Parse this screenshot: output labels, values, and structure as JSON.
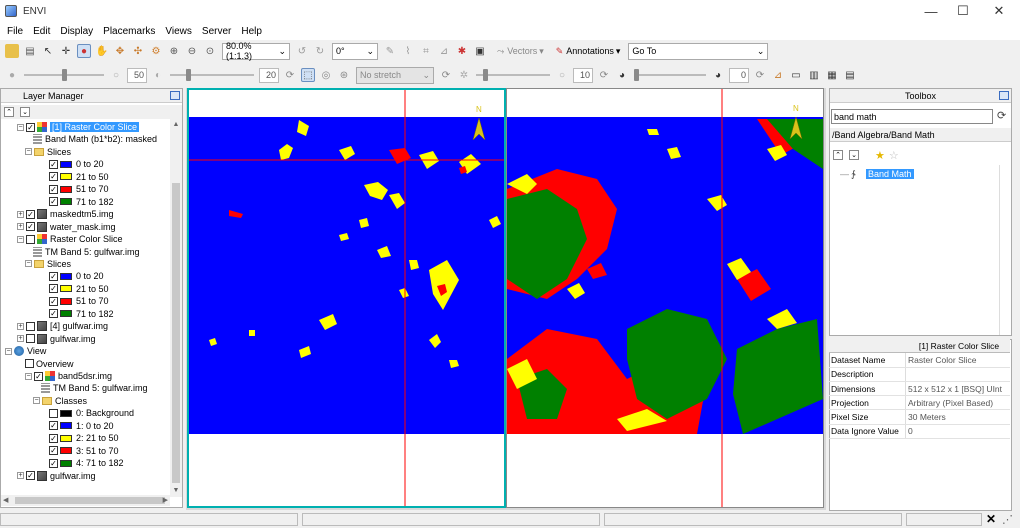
{
  "window": {
    "title": "ENVI",
    "controls": {
      "minimize": "—",
      "maximize": "☐",
      "close": "✕"
    }
  },
  "menu": [
    "File",
    "Edit",
    "Display",
    "Placemarks",
    "Views",
    "Server",
    "Help"
  ],
  "toolbar": {
    "zoom_value": "80.0% (1:1.3)",
    "rotation_value": "0°",
    "vectors_label": "Vectors",
    "annotations_label": "Annotations",
    "goto_value": "Go To",
    "brightness_value": "50",
    "contrast_value": "20",
    "stretch_value": "No stretch",
    "sharpen_value": "10",
    "transparency_value": "0",
    "brightness_level": 0.5,
    "contrast_level": 0.2,
    "sharpen_level": 0.1,
    "transparency_level": 0.0
  },
  "layer_manager": {
    "title": "Layer Manager",
    "items": [
      {
        "label": "[1] Raster Color Slice",
        "type": "colorslice",
        "checked": true,
        "expanded": true,
        "selected": true
      },
      {
        "label": "Band Math (b1*b2): masked",
        "type": "band"
      },
      {
        "label": "Slices",
        "type": "folder",
        "expanded": true
      },
      {
        "label": "0 to 20",
        "type": "slice",
        "checked": true,
        "color": "#0000ff"
      },
      {
        "label": "21 to 50",
        "type": "slice",
        "checked": true,
        "color": "#ffff00"
      },
      {
        "label": "51 to 70",
        "type": "slice",
        "checked": true,
        "color": "#ff0000"
      },
      {
        "label": "71 to 182",
        "type": "slice",
        "checked": true,
        "color": "#008000"
      },
      {
        "label": "maskedtm5.img",
        "type": "image",
        "checked": true,
        "expanded": false
      },
      {
        "label": "water_mask.img",
        "type": "image",
        "checked": true,
        "expanded": false
      },
      {
        "label": "Raster Color Slice",
        "type": "colorslice",
        "checked": false,
        "expanded": true
      },
      {
        "label": "TM Band 5: gulfwar.img",
        "type": "band"
      },
      {
        "label": "Slices",
        "type": "folder",
        "expanded": true
      },
      {
        "label": "0 to 20",
        "type": "slice",
        "checked": true,
        "color": "#0000ff"
      },
      {
        "label": "21 to 50",
        "type": "slice",
        "checked": true,
        "color": "#ffff00"
      },
      {
        "label": "51 to 70",
        "type": "slice",
        "checked": true,
        "color": "#ff0000"
      },
      {
        "label": "71 to 182",
        "type": "slice",
        "checked": true,
        "color": "#008000"
      },
      {
        "label": "[4] gulfwar.img",
        "type": "image",
        "checked": false,
        "expanded": false
      },
      {
        "label": "gulfwar.img",
        "type": "image",
        "checked": false,
        "expanded": false
      },
      {
        "label": "View",
        "type": "view",
        "expanded": true
      },
      {
        "label": "Overview",
        "type": "plain",
        "checked": false
      },
      {
        "label": "band5dsr.img",
        "type": "colorslice",
        "checked": true,
        "expanded": true
      },
      {
        "label": "TM Band 5: gulfwar.img",
        "type": "band"
      },
      {
        "label": "Classes",
        "type": "folder",
        "expanded": true
      },
      {
        "label": "0: Background",
        "type": "slice",
        "checked": false,
        "color": "#000000"
      },
      {
        "label": "1: 0 to 20",
        "type": "slice",
        "checked": true,
        "color": "#0000ff"
      },
      {
        "label": "2: 21 to 50",
        "type": "slice",
        "checked": true,
        "color": "#ffff00"
      },
      {
        "label": "3: 51 to 70",
        "type": "slice",
        "checked": true,
        "color": "#ff0000"
      },
      {
        "label": "4: 71 to 182",
        "type": "slice",
        "checked": true,
        "color": "#008000"
      },
      {
        "label": "gulfwar.img",
        "type": "image",
        "checked": true,
        "expanded": false
      }
    ]
  },
  "views": {
    "north_label": "N",
    "colors": {
      "water": "#0000ff",
      "low": "#ffff00",
      "mid": "#ff0000",
      "high": "#008000",
      "crosshair": "#ff0000",
      "active_border": "#00b0b0"
    }
  },
  "toolbox": {
    "title": "Toolbox",
    "search_value": "band math",
    "path": "/Band Algebra/Band Math",
    "result": "Band Math"
  },
  "properties": {
    "header": "[1] Raster Color Slice",
    "rows": [
      {
        "key": "Dataset Name",
        "value": "Raster Color Slice"
      },
      {
        "key": "Description",
        "value": ""
      },
      {
        "key": "Dimensions",
        "value": "512 x 512 x 1 [BSQ] UInt"
      },
      {
        "key": "Projection",
        "value": "Arbitrary (Pixel Based)"
      },
      {
        "key": "Pixel Size",
        "value": "30 Meters"
      },
      {
        "key": "Data Ignore Value",
        "value": "0"
      }
    ]
  },
  "statusbar": {
    "close_glyph": "✕"
  }
}
